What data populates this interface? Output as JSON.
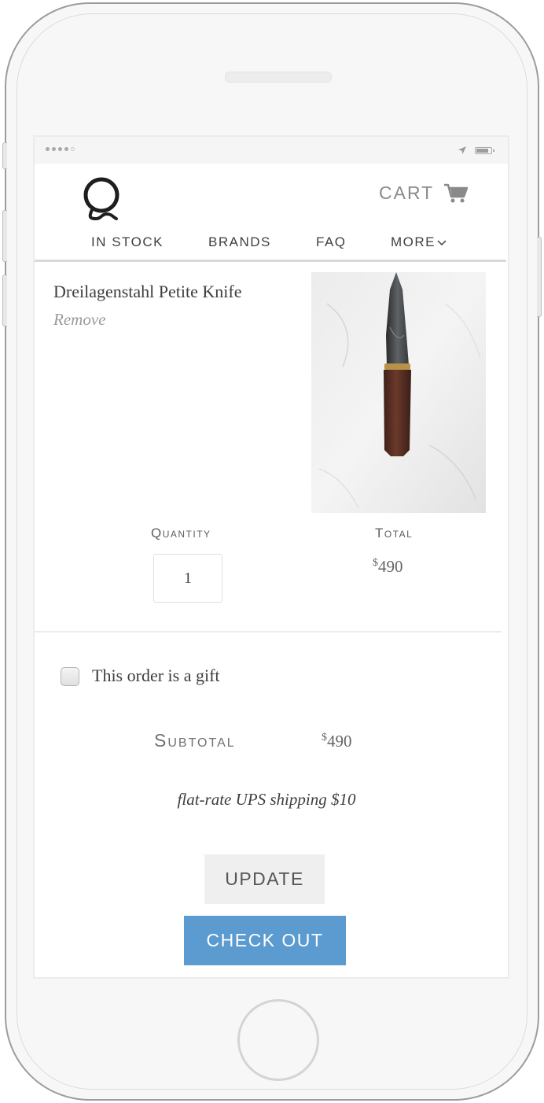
{
  "colors": {
    "accent": "#5b9bcf",
    "text": "#3d3d3d",
    "muted": "#9a9a9a",
    "button_gray": "#efefef"
  },
  "header": {
    "logo_icon": "q-logo-icon",
    "cart_label": "CART",
    "cart_icon": "cart-icon"
  },
  "nav": {
    "items": [
      {
        "label": "IN STOCK"
      },
      {
        "label": "BRANDS"
      },
      {
        "label": "FAQ"
      },
      {
        "label": "MORE"
      }
    ],
    "more_icon": "chevron-down-icon"
  },
  "cart_item": {
    "name": "Dreilagenstahl Petite Knife",
    "remove_label": "Remove",
    "image": "knife-photo",
    "quantity_label": "Quantity",
    "quantity_value": "1",
    "total_label": "Total",
    "total_currency": "$",
    "total_amount": "490"
  },
  "gift": {
    "label": "This order is a gift",
    "checked": false
  },
  "summary": {
    "subtotal_label": "Subtotal",
    "subtotal_currency": "$",
    "subtotal_amount": "490",
    "shipping_note": "flat-rate UPS shipping $10"
  },
  "actions": {
    "update_label": "UPDATE",
    "checkout_label": "CHECK OUT"
  }
}
